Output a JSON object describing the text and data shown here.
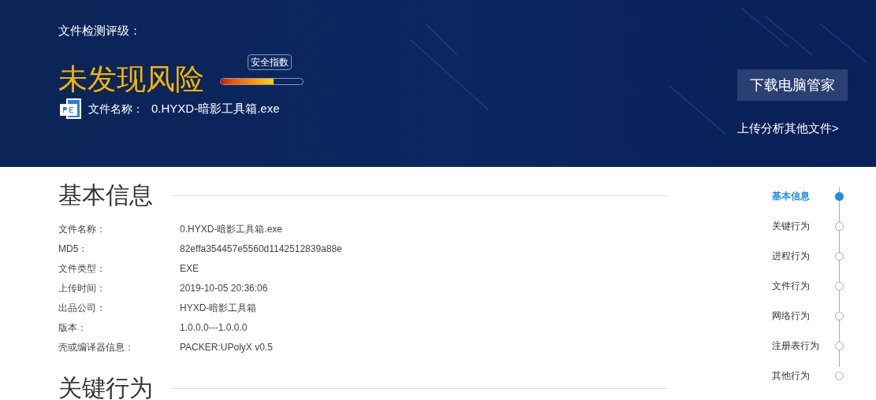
{
  "header": {
    "rating_label": "文件检测评级：",
    "verdict": "未发现风险",
    "meter": {
      "label": "安全指数",
      "level": 0.64
    },
    "file_label": "文件名称：",
    "file_name": "0.HYXD-暗影工具箱.exe",
    "download_button": "下载电脑管家",
    "upload_link": "上传分析其他文件>"
  },
  "sections": [
    {
      "title": "基本信息",
      "rows": [
        {
          "label": "文件名称：",
          "value": "0.HYXD-暗影工具箱.exe"
        },
        {
          "label": "MD5：",
          "value": "82effa354457e5560d1142512839a88e"
        },
        {
          "label": "文件类型：",
          "value": "EXE"
        },
        {
          "label": "上传时间：",
          "value": "2019-10-05 20:36:06"
        },
        {
          "label": "出品公司：",
          "value": "HYXD-暗影工具箱"
        },
        {
          "label": "版本：",
          "value": "1.0.0.0---1.0.0.0"
        },
        {
          "label": "壳或编译器信息：",
          "value": "PACKER:UPolyX v0.5"
        }
      ]
    },
    {
      "title": "关键行为"
    }
  ],
  "nav": [
    {
      "label": "基本信息",
      "selected": true
    },
    {
      "label": "关键行为",
      "selected": false
    },
    {
      "label": "进程行为",
      "selected": false
    },
    {
      "label": "文件行为",
      "selected": false
    },
    {
      "label": "网络行为",
      "selected": false
    },
    {
      "label": "注册表行为",
      "selected": false
    },
    {
      "label": "其他行为",
      "selected": false
    }
  ]
}
